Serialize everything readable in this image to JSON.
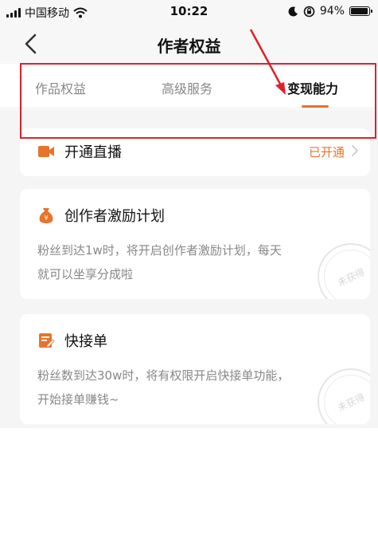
{
  "status_bar": {
    "carrier": "中国移动",
    "time": "10:22",
    "battery_percent": "94%",
    "battery_level": 0.94
  },
  "nav": {
    "title": "作者权益",
    "back_icon": "chevron-left-icon"
  },
  "tabs": [
    {
      "label": "作品权益",
      "active": false
    },
    {
      "label": "高级服务",
      "active": false
    },
    {
      "label": "变现能力",
      "active": true
    }
  ],
  "cards": {
    "live": {
      "title": "开通直播",
      "status": "已开通",
      "icon": "video-camera-icon"
    },
    "incentive": {
      "title": "创作者激励计划",
      "description": "粉丝到达1w时，将开启创作者激励计划，每天就可以坐享分成啦",
      "stamp": "未获得",
      "icon": "money-bag-icon"
    },
    "order": {
      "title": "快接单",
      "description": "粉丝数到达30w时，将有权限开启快接单功能，开始接单赚钱~",
      "stamp": "未获得",
      "icon": "edit-note-icon"
    }
  },
  "colors": {
    "accent": "#e8742c",
    "annotation": "#e0202a"
  }
}
